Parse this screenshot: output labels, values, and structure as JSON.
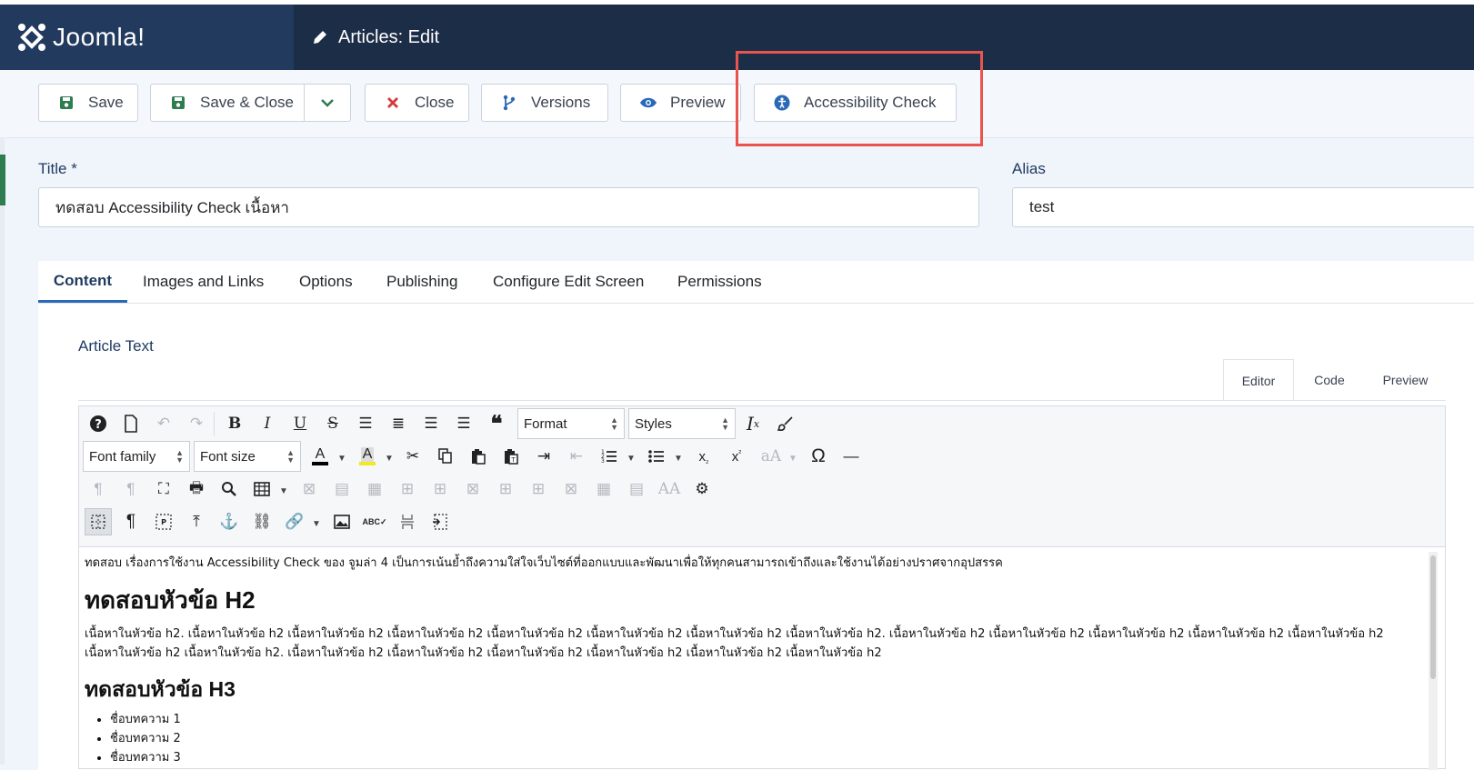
{
  "header": {
    "logo_text": "Joomla!",
    "page_title": "Articles: Edit"
  },
  "toolbar": {
    "save": "Save",
    "save_close": "Save & Close",
    "close": "Close",
    "versions": "Versions",
    "preview": "Preview",
    "accessibility": "Accessibility Check"
  },
  "form": {
    "title_label": "Title *",
    "title_value": "ทดสอบ Accessibility Check เนื้อหา",
    "alias_label": "Alias",
    "alias_value": "test"
  },
  "tabs": [
    "Content",
    "Images and Links",
    "Options",
    "Publishing",
    "Configure Edit Screen",
    "Permissions"
  ],
  "article_text_label": "Article Text",
  "editor_tabs": [
    "Editor",
    "Code",
    "Preview"
  ],
  "editor_toolbar": {
    "format": "Format",
    "styles": "Styles",
    "font_family": "Font family",
    "font_size": "Font size"
  },
  "content": {
    "intro": "ทดสอบ เรื่องการใช้งาน  Accessibility Check ของ จูมล่า 4 เป็นการเน้นย้ำถึงความใส่ใจเว็บไซต์ที่ออกแบบและพัฒนาเพื่อให้ทุกคนสามารถเข้าถึงและใช้งานได้อย่างปราศจากอุปสรรค",
    "h2": "ทดสอบหัวข้อ H2",
    "paragraph": "เนื้อหาในหัวข้อ h2. เนื้อหาในหัวข้อ h2 เนื้อหาในหัวข้อ h2 เนื้อหาในหัวข้อ h2 เนื้อหาในหัวข้อ h2 เนื้อหาในหัวข้อ h2 เนื้อหาในหัวข้อ h2 เนื้อหาในหัวข้อ h2. เนื้อหาในหัวข้อ h2 เนื้อหาในหัวข้อ h2 เนื้อหาในหัวข้อ h2 เนื้อหาในหัวข้อ h2 เนื้อหาในหัวข้อ h2 เนื้อหาในหัวข้อ h2 เนื้อหาในหัวข้อ h2. เนื้อหาในหัวข้อ h2 เนื้อหาในหัวข้อ h2 เนื้อหาในหัวข้อ h2 เนื้อหาในหัวข้อ h2 เนื้อหาในหัวข้อ h2 เนื้อหาในหัวข้อ h2",
    "h3": "ทดสอบหัวข้อ H3",
    "list": [
      "ชื่อบทความ 1",
      "ชื่อบทความ 2",
      "ชื่อบทความ 3"
    ]
  },
  "colors": {
    "header_bg": "#1c2d47",
    "logo_bg": "#213a5e",
    "highlight": "#e8554e",
    "save_icon": "#2e7d4f",
    "close_icon": "#d43a3a",
    "accent_blue": "#2a69b8"
  }
}
